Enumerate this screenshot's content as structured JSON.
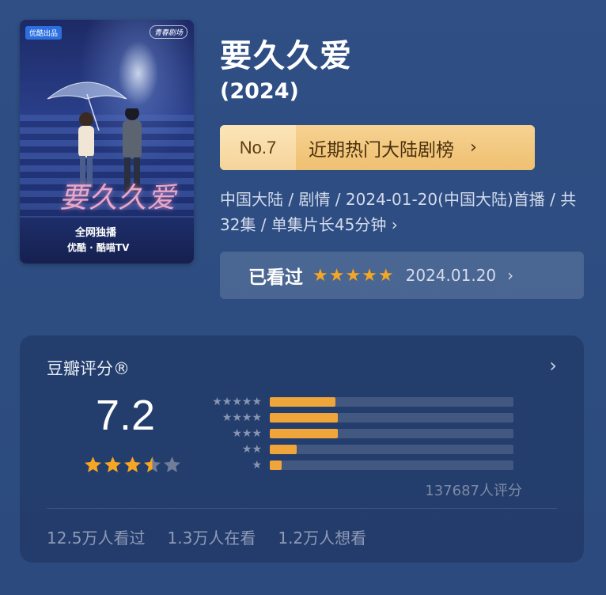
{
  "poster": {
    "badge_left": "优酷出品",
    "badge_right": "青春剧场",
    "title_art": "要久久爱",
    "exclusive": "全网独播",
    "platforms": "优酷 · 酷喵TV"
  },
  "movie": {
    "title": "要久久爱",
    "year": "(2024)"
  },
  "rank": {
    "number": "No.7",
    "label": "近期热门大陆剧榜",
    "chevron": "›"
  },
  "meta": {
    "info": "中国大陆 / 剧情 / 2024-01-20(中国大陆)首播 / 共32集 / 单集片长45分钟 ›"
  },
  "watched": {
    "label": "已看过",
    "stars": "★★★★★",
    "date": "2024.01.20",
    "chevron": "›"
  },
  "rating": {
    "title": "豆瓣评分®",
    "score": "7.2",
    "star_value": 3.5,
    "chevron": "›",
    "distribution": [
      {
        "stars": "★★★★★",
        "fraction": 0.27
      },
      {
        "stars": "★★★★",
        "fraction": 0.28
      },
      {
        "stars": "★★★",
        "fraction": 0.28
      },
      {
        "stars": "★★",
        "fraction": 0.11
      },
      {
        "stars": "★",
        "fraction": 0.05
      }
    ],
    "count": "137687人评分",
    "stats": [
      "12.5万人看过",
      "1.3万人在看",
      "1.2万人想看"
    ]
  },
  "colors": {
    "background": "#2e4e83",
    "accent_star": "#f5a623",
    "bar_fill": "#f0a53a",
    "rank_banner": "#f1c57e"
  }
}
